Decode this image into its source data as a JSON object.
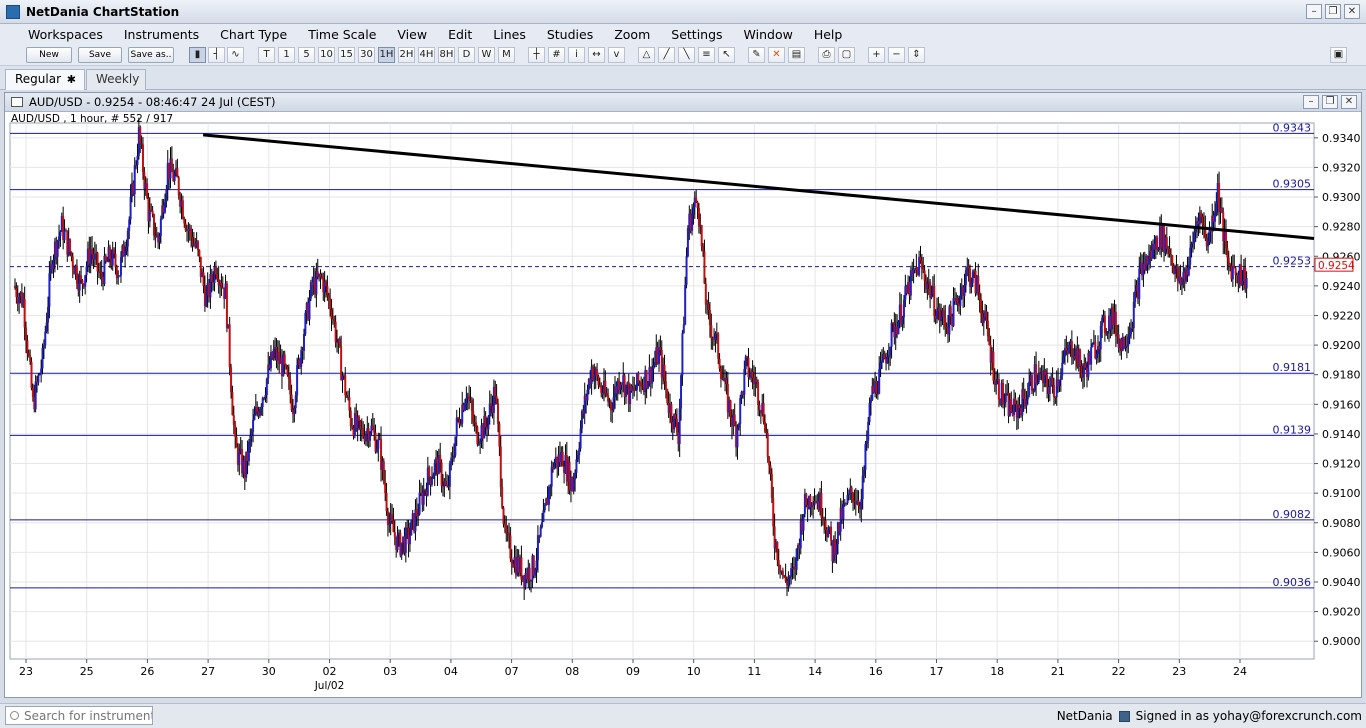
{
  "app": {
    "title": "NetDania ChartStation"
  },
  "menu": [
    "Workspaces",
    "Instruments",
    "Chart Type",
    "Time Scale",
    "View",
    "Edit",
    "Lines",
    "Studies",
    "Zoom",
    "Settings",
    "Window",
    "Help"
  ],
  "toolbar": {
    "new_label": "New",
    "save_label": "Save",
    "saveas_label": "Save as..",
    "timescales": [
      "T",
      "1",
      "5",
      "10",
      "15",
      "30",
      "1H",
      "2H",
      "4H",
      "8H",
      "D",
      "W",
      "M"
    ],
    "active_timescale": "1H"
  },
  "tabs": [
    {
      "label": "Regular",
      "close": "✱"
    },
    {
      "label": "Weekly"
    }
  ],
  "chart_window": {
    "title": "AUD/USD - 0.9254 - 08:46:47  24 Jul (CEST)",
    "subtitle": "AUD/USD , 1 hour, # 552 / 917"
  },
  "status": {
    "search_placeholder": "Search for instrument",
    "brand": "NetDania",
    "signed_in": "Signed in as yohay@forexcrunch.com"
  },
  "colors": {
    "up": "#2020c8",
    "down": "#c01010",
    "hline": "#1a1a9c",
    "trend": "#000000",
    "price_tag": "#d01010"
  },
  "chart_data": {
    "type": "candlestick",
    "instrument": "AUD/USD",
    "ylim": [
      0.8988,
      0.935
    ],
    "y_ticks": [
      "0.9340",
      "0.9320",
      "0.9300",
      "0.9280",
      "0.9260",
      "0.9240",
      "0.9220",
      "0.9200",
      "0.9180",
      "0.9160",
      "0.9140",
      "0.9120",
      "0.9100",
      "0.9080",
      "0.9060",
      "0.9040",
      "0.9020",
      "0.9000"
    ],
    "x_ticks": [
      "23",
      "25",
      "26",
      "27",
      "30",
      "02",
      "03",
      "04",
      "07",
      "08",
      "09",
      "10",
      "11",
      "14",
      "16",
      "17",
      "18",
      "21",
      "22",
      "23",
      "24"
    ],
    "x_sublabel": "Jul/02",
    "horizontal_levels": [
      {
        "value": 0.9343,
        "label": "0.9343"
      },
      {
        "value": 0.9305,
        "label": "0.9305"
      },
      {
        "value": 0.9253,
        "label": "0.9253",
        "dashed": true
      },
      {
        "value": 0.9181,
        "label": "0.9181"
      },
      {
        "value": 0.9139,
        "label": "0.9139"
      },
      {
        "value": 0.9082,
        "label": "0.9082"
      },
      {
        "value": 0.9036,
        "label": "0.9036"
      }
    ],
    "current_price": "0.9254",
    "trendline": {
      "from": 0.9342,
      "to": 0.9272
    },
    "price_path": [
      0.924,
      0.923,
      0.916,
      0.919,
      0.926,
      0.928,
      0.926,
      0.924,
      0.9265,
      0.9245,
      0.926,
      0.925,
      0.9285,
      0.9342,
      0.929,
      0.927,
      0.932,
      0.931,
      0.928,
      0.9265,
      0.923,
      0.9255,
      0.9235,
      0.913,
      0.9115,
      0.915,
      0.917,
      0.9195,
      0.9185,
      0.916,
      0.9205,
      0.924,
      0.9245,
      0.9225,
      0.9185,
      0.915,
      0.914,
      0.9145,
      0.913,
      0.908,
      0.9065,
      0.907,
      0.909,
      0.911,
      0.912,
      0.91,
      0.9145,
      0.917,
      0.914,
      0.9145,
      0.917,
      0.907,
      0.9055,
      0.9045,
      0.905,
      0.908,
      0.912,
      0.9125,
      0.9105,
      0.915,
      0.9185,
      0.917,
      0.916,
      0.918,
      0.9165,
      0.9175,
      0.918,
      0.9195,
      0.916,
      0.914,
      0.928,
      0.93,
      0.922,
      0.92,
      0.9165,
      0.914,
      0.9185,
      0.9175,
      0.915,
      0.907,
      0.904,
      0.9045,
      0.909,
      0.91,
      0.909,
      0.906,
      0.9085,
      0.91,
      0.9095,
      0.9165,
      0.918,
      0.9205,
      0.922,
      0.924,
      0.9255,
      0.924,
      0.922,
      0.9215,
      0.923,
      0.925,
      0.924,
      0.921,
      0.9175,
      0.916,
      0.9155,
      0.9165,
      0.918,
      0.9175,
      0.917,
      0.919,
      0.92,
      0.918,
      0.9195,
      0.921,
      0.922,
      0.92,
      0.9215,
      0.925,
      0.926,
      0.9275,
      0.9265,
      0.924,
      0.9255,
      0.929,
      0.927,
      0.9305,
      0.9255,
      0.925,
      0.9245
    ]
  }
}
